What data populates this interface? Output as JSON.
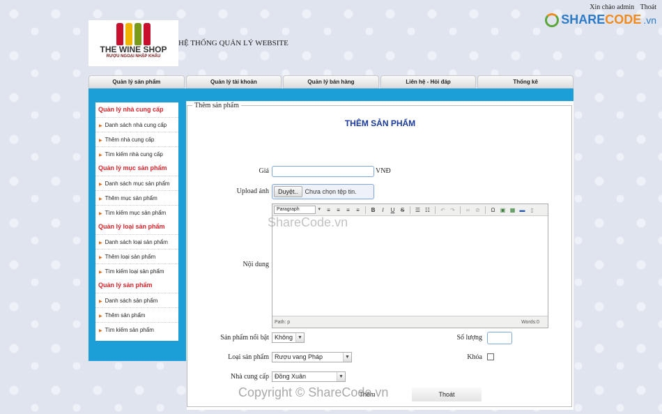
{
  "header": {
    "greeting": "Xin chào admin",
    "logout_link": "Thoát",
    "brand_prefix": "SHARE",
    "brand_suffix": "CODE",
    "brand_domain": ".vn",
    "logo_title": "THE WINE SHOP",
    "logo_subtitle": "RƯỢU NGOẠI NHẬP KHẨU",
    "system_title": "HỆ THỐNG QUẢN LÝ WEBSITE"
  },
  "nav": {
    "items": [
      {
        "label": "Quản lý sản phẩm"
      },
      {
        "label": "Quản lý tài khoản"
      },
      {
        "label": "Quản lý bán hàng"
      },
      {
        "label": "Liên hệ - Hỏi đáp"
      },
      {
        "label": "Thống kê"
      }
    ]
  },
  "sidebar": {
    "groups": [
      {
        "title": "Quản lý nhà cung cấp",
        "items": [
          "Danh sách nhà cung cấp",
          "Thêm nhà cung cấp",
          "Tìm kiếm nhà cung cấp"
        ]
      },
      {
        "title": "Quản lý mục sản phẩm",
        "items": [
          "Danh sách mục sản phẩm",
          "Thêm mục sản phẩm",
          "Tìm kiếm mục sản phẩm"
        ]
      },
      {
        "title": "Quản lý loại sản phẩm",
        "items": [
          "Danh sách loại sản phẩm",
          "Thêm loại sản phẩm",
          "Tìm kiếm loại sản phẩm"
        ]
      },
      {
        "title": "Quản lý sản phẩm",
        "items": [
          "Danh sách sản phẩm",
          "Thêm sản phẩm",
          "Tìm kiếm sản phẩm"
        ]
      }
    ]
  },
  "form": {
    "legend": "Thêm sản phẩm",
    "title": "THÊM SẢN PHẨM",
    "price_label": "Giá",
    "price_value": "",
    "price_suffix": "VNĐ",
    "upload_label": "Upload ảnh",
    "upload_button": "Duyệt..",
    "upload_status": "Chưa chọn tệp tin.",
    "content_label": "Nội dung",
    "editor": {
      "format_value": "Paragraph",
      "path": "Path: p",
      "words": "Words:0"
    },
    "featured_label": "Sản phẩm nổi bật",
    "featured_value": "Không",
    "quantity_label": "Số lượng",
    "quantity_value": "",
    "category_label": "Loại sản phẩm",
    "category_value": "Rượu vang Pháp",
    "lock_label": "Khóa",
    "lock_checked": false,
    "supplier_label": "Nhà cung cấp",
    "supplier_value": "Đồng Xuân",
    "submit_label": "Thêm",
    "cancel_label": "Thoát"
  },
  "watermarks": {
    "center": "ShareCode.vn",
    "bottom": "Copyright © ShareCode.vn"
  }
}
